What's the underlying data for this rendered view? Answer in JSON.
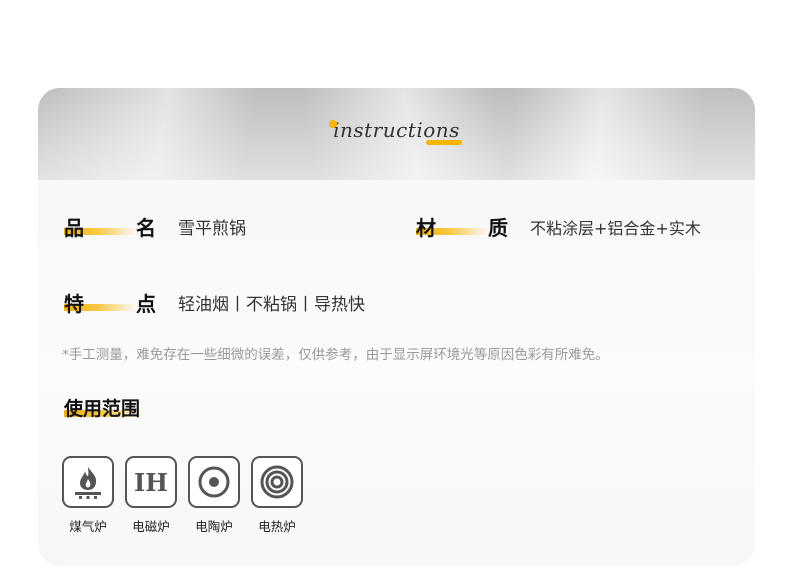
{
  "banner": {
    "title": "instructions"
  },
  "specs": {
    "name_label_c1": "品",
    "name_label_c2": "名",
    "name_value": "雪平煎锅",
    "material_label_c1": "材",
    "material_label_c2": "质",
    "material_value": "不粘涂层+铝合金+实木",
    "feature_label_c1": "特",
    "feature_label_c2": "点",
    "feature_value": "轻油烟丨不粘锅丨导热快"
  },
  "note": "*手工测量，难免存在一些细微的误差，仅供参考，由于显示屏环境光等原因色彩有所难免。",
  "usage": {
    "title": "使用范围",
    "items": [
      {
        "icon": "gas-flame-icon",
        "label": "煤气炉"
      },
      {
        "icon": "ih-icon",
        "label": "电磁炉",
        "icon_text": "IH"
      },
      {
        "icon": "ceramic-hob-icon",
        "label": "电陶炉"
      },
      {
        "icon": "electric-coil-icon",
        "label": "电热炉"
      }
    ]
  },
  "colors": {
    "accent": "#f5b400",
    "text": "#222222",
    "note": "#999999"
  }
}
